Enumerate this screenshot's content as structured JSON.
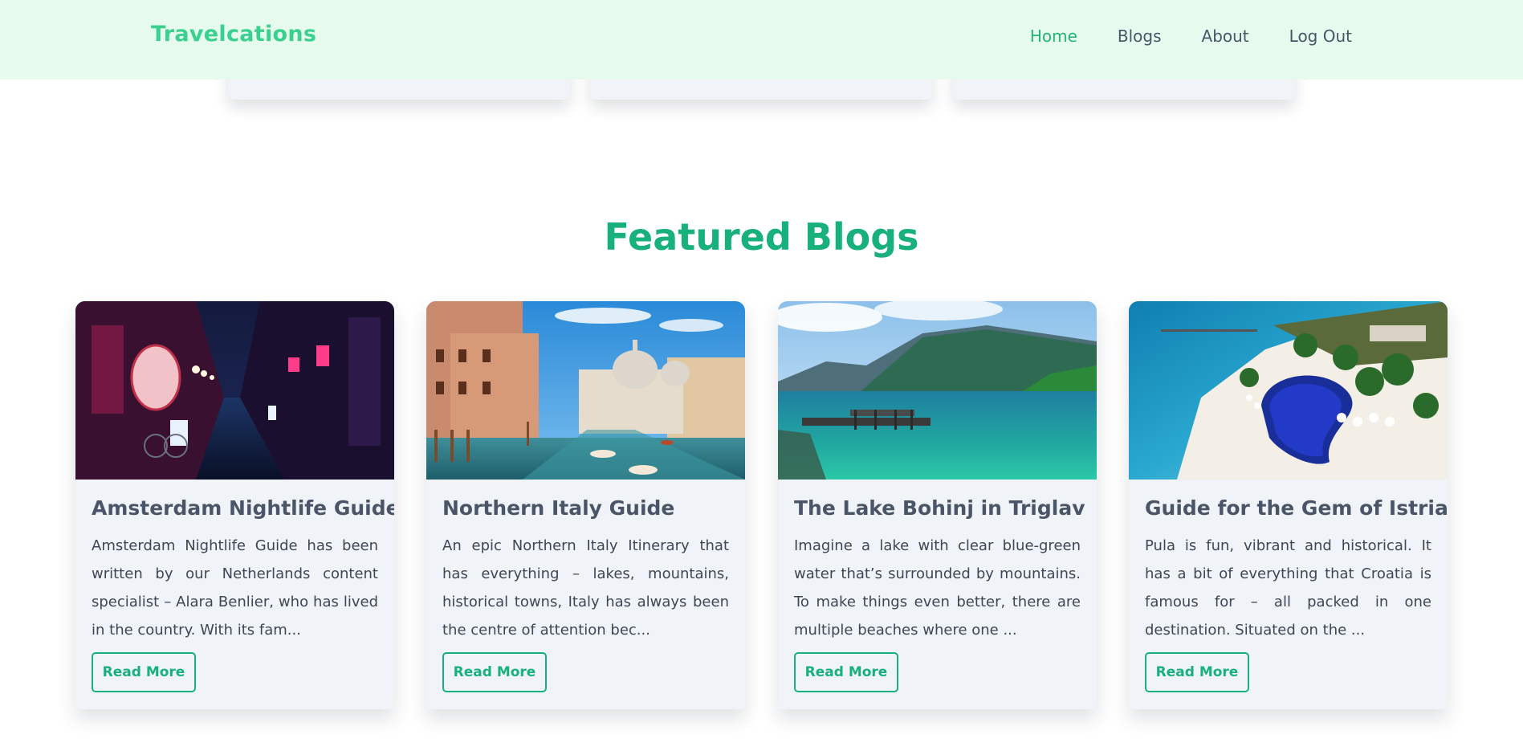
{
  "brand": {
    "name": "Travelcations"
  },
  "nav": {
    "items": [
      {
        "label": "Home",
        "active": true
      },
      {
        "label": "Blogs",
        "active": false
      },
      {
        "label": "About",
        "active": false
      },
      {
        "label": "Log Out",
        "active": false
      }
    ]
  },
  "section": {
    "title": "Featured Blogs"
  },
  "blogs": [
    {
      "title": "Amsterdam Nightlife Guide",
      "excerpt": "Amsterdam Nightlife Guide has been written by our Netherlands content specialist – Alara Benlier, who has lived in the country. With its fam...",
      "button": "Read More",
      "image": "night-street-photo"
    },
    {
      "title": "Northern Italy Guide",
      "excerpt": "An epic Northern Italy Itinerary that has everything – lakes, mountains, historical towns, Italy has always been the centre of attention bec...",
      "button": "Read More",
      "image": "venice-canal-photo"
    },
    {
      "title": "The Lake Bohinj in Triglav",
      "excerpt": "Imagine a lake with clear blue-green water that’s surrounded by mountains. To make things even better, there are multiple beaches where one ...",
      "button": "Read More",
      "image": "mountain-lake-photo"
    },
    {
      "title": "Guide for the Gem of Istria",
      "excerpt": "Pula is fun, vibrant and historical. It has a bit of everything that Croatia is famous for – all packed in one destination. Situated on the ...",
      "button": "Read More",
      "image": "beach-resort-photo"
    }
  ],
  "colors": {
    "brand": "#3ad08f",
    "accent": "#18b07b",
    "nav_bg": "#e6fbee",
    "card_bg": "#f0f3f8",
    "text": "#4a5568"
  }
}
